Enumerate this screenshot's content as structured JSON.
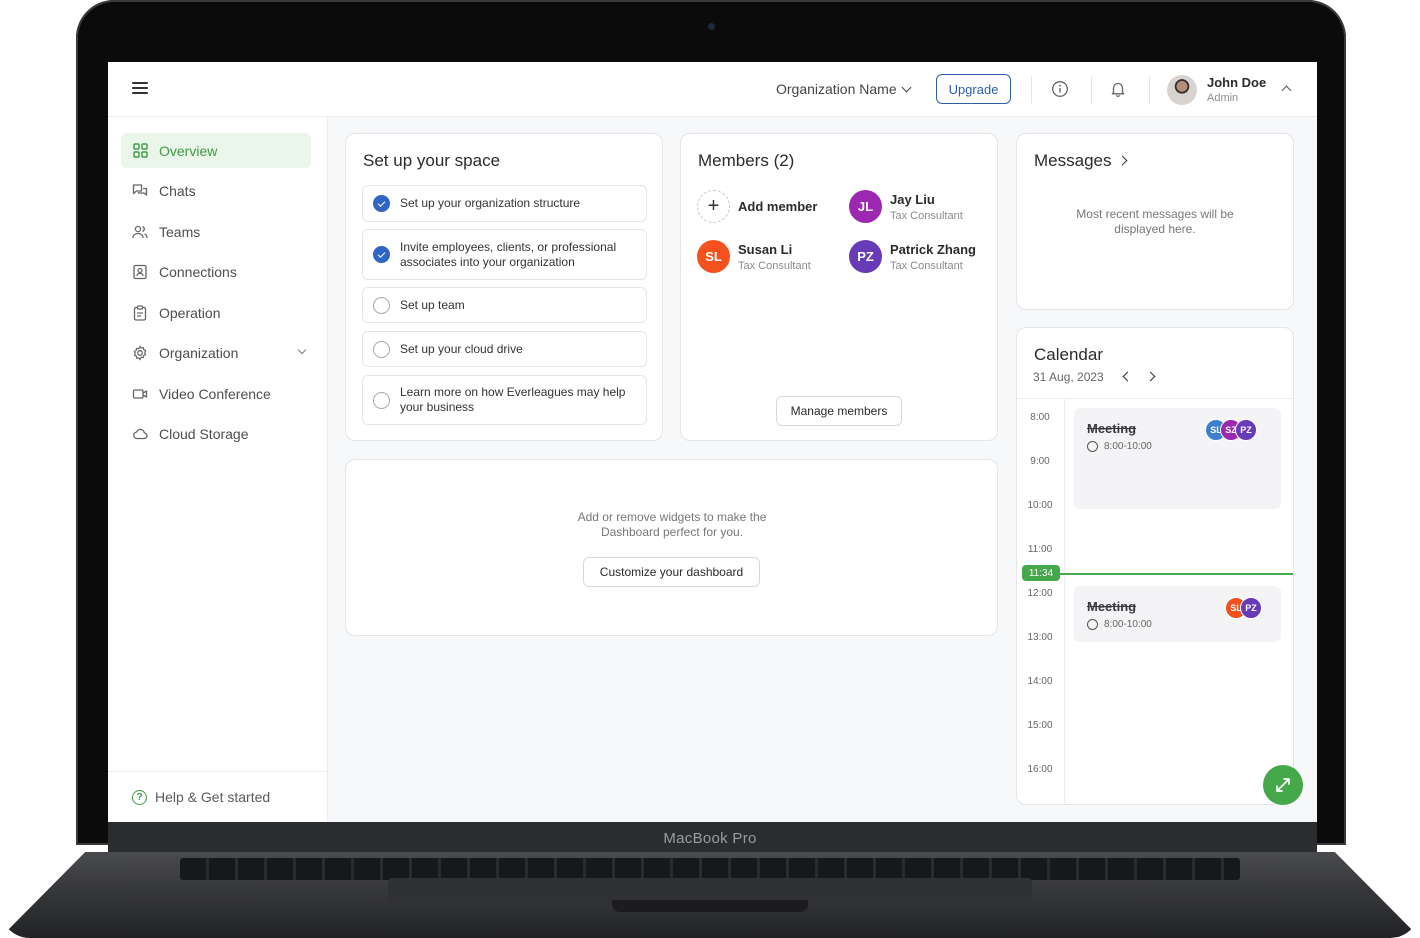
{
  "device": {
    "brand": "MacBook Pro"
  },
  "header": {
    "org_name": "Organization Name",
    "upgrade_label": "Upgrade",
    "info_icon": "info-icon",
    "bell_icon": "bell-icon",
    "user": {
      "name": "John Doe",
      "role": "Admin"
    }
  },
  "sidebar": {
    "items": [
      {
        "label": "Overview",
        "icon": "grid-icon",
        "active": true
      },
      {
        "label": "Chats",
        "icon": "chat-icon"
      },
      {
        "label": "Teams",
        "icon": "users-icon"
      },
      {
        "label": "Connections",
        "icon": "contact-card-icon"
      },
      {
        "label": "Operation",
        "icon": "clipboard-icon"
      },
      {
        "label": "Organization",
        "icon": "gear-icon"
      },
      {
        "label": "Video Conference",
        "icon": "video-icon"
      },
      {
        "label": "Cloud Storage",
        "icon": "cloud-icon"
      }
    ],
    "help_label": "Help & Get started"
  },
  "setup": {
    "title": "Set up your space",
    "tasks": [
      {
        "label": "Set up your organization structure",
        "done": true
      },
      {
        "label": "Invite employees, clients, or professional associates into your organization",
        "done": true
      },
      {
        "label": "Set up team",
        "done": false
      },
      {
        "label": "Set up your cloud drive",
        "done": false
      },
      {
        "label": "Learn more on how Everleagues may help your business",
        "done": false
      }
    ]
  },
  "members": {
    "title": "Members (2)",
    "add_label": "Add member",
    "list": [
      {
        "initials": "JL",
        "name": "Jay Liu",
        "role": "Tax Consultant",
        "color": "#9c27b0"
      },
      {
        "initials": "SL",
        "name": "Susan Li",
        "role": "Tax Consultant",
        "color": "#f4511e"
      },
      {
        "initials": "PZ",
        "name": "Patrick Zhang",
        "role": "Tax Consultant",
        "color": "#673ab7"
      }
    ],
    "manage_label": "Manage members"
  },
  "messages": {
    "title": "Messages",
    "empty_text": "Most recent messages will be displayed here."
  },
  "widgets": {
    "hint": "Add or remove widgets to make the Dashboard perfect for you.",
    "button_label": "Customize your dashboard"
  },
  "calendar": {
    "title": "Calendar",
    "date": "31 Aug, 2023",
    "hours": [
      "8:00",
      "9:00",
      "10:00",
      "11:00",
      "12:00",
      "13:00",
      "14:00",
      "15:00",
      "16:00"
    ],
    "now": "11:34",
    "events": [
      {
        "title": "Meeting",
        "time": "8:00-10:00",
        "attendees": [
          {
            "i": "SL",
            "c": "#3f7fd0"
          },
          {
            "i": "SZ",
            "c": "#9c27b0"
          },
          {
            "i": "PZ",
            "c": "#673ab7"
          }
        ]
      },
      {
        "title": "Meeting",
        "time": "8:00-10:00",
        "attendees": [
          {
            "i": "SL",
            "c": "#f4511e"
          },
          {
            "i": "PZ",
            "c": "#673ab7"
          }
        ]
      }
    ]
  },
  "colors": {
    "accent": "#45a84b",
    "primary": "#2f5ea8"
  }
}
